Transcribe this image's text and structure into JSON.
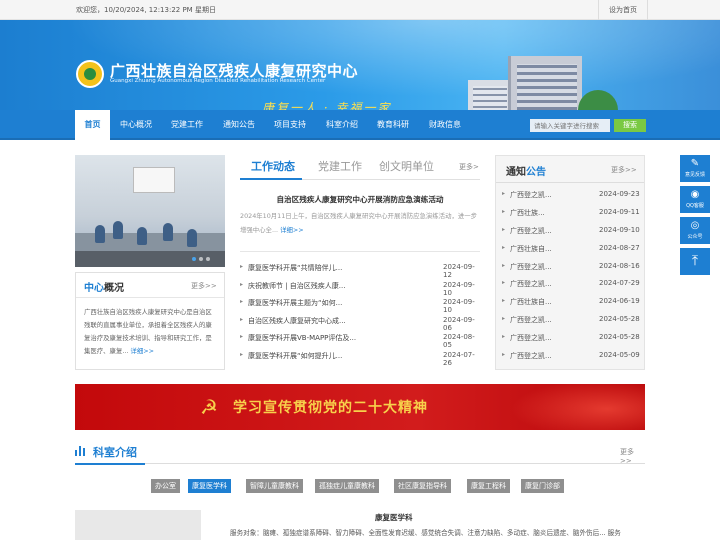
{
  "topbar": {
    "welcome": "欢迎您，10/20/2024, 12:13:22 PM 星期日",
    "set_home": "设为首页"
  },
  "header": {
    "title": "广西壮族自治区残疾人康复研究中心",
    "subtitle": "Guangxi Zhuang Autonomous Region Disabled Rehabilitation Research Center",
    "slogan": "康复一人 · 幸福一家"
  },
  "nav": {
    "items": [
      {
        "label": "首页",
        "active": true
      },
      {
        "label": "中心概况"
      },
      {
        "label": "党建工作"
      },
      {
        "label": "通知公告"
      },
      {
        "label": "项目支持"
      },
      {
        "label": "科室介绍"
      },
      {
        "label": "教育科研"
      },
      {
        "label": "财政信息"
      }
    ],
    "search_placeholder": "请输入关键字进行搜索",
    "search_button": "搜索"
  },
  "intro": {
    "title_a": "中心",
    "title_b": "概况",
    "more": "更多>>",
    "text": "广西壮族自治区残疾人康复研究中心是自治区残联的直属事业单位，承担着全区残疾人的康复治疗及康复技术培训、指导和研究工作，是集医疗、康复...",
    "link": "详细>>"
  },
  "news": {
    "tabs": [
      "工作动态",
      "党建工作",
      "创文明单位"
    ],
    "more": "更多>",
    "headline": "自治区残疾人康复研究中心开展消防应急演练活动",
    "summary": "2024年10月11日上午，自治区残疾人康复研究中心开展消防应急演练活动，进一步增强中心全...",
    "summary_link": "详细>>",
    "items": [
      {
        "title": "康复医学科开展“共情陪伴儿...",
        "date": "2024-09-12"
      },
      {
        "title": "庆祝教师节 | 自治区残疾人康...",
        "date": "2024-09-10"
      },
      {
        "title": "康复医学科开展主题为“如何...",
        "date": "2024-09-10"
      },
      {
        "title": "自治区残疾人康复研究中心成...",
        "date": "2024-09-06"
      },
      {
        "title": "康复医学科开展VB-MAPP评估及...",
        "date": "2024-08-05"
      },
      {
        "title": "康复医学科开展“如何提升儿...",
        "date": "2024-07-26"
      }
    ]
  },
  "notice": {
    "title_a": "通知",
    "title_b": "公告",
    "more": "更多>>",
    "items": [
      {
        "title": "广西登之凯...",
        "date": "2024-09-23"
      },
      {
        "title": "广西壮族...",
        "date": "2024-09-11"
      },
      {
        "title": "广西登之凯...",
        "date": "2024-09-10"
      },
      {
        "title": "广西壮族自...",
        "date": "2024-08-27"
      },
      {
        "title": "广西登之凯...",
        "date": "2024-08-16"
      },
      {
        "title": "广西登之凯...",
        "date": "2024-07-29"
      },
      {
        "title": "广西壮族自...",
        "date": "2024-06-19"
      },
      {
        "title": "广西登之凯...",
        "date": "2024-05-28"
      },
      {
        "title": "广西登之凯...",
        "date": "2024-05-28"
      },
      {
        "title": "广西登之凯...",
        "date": "2024-05-09"
      }
    ]
  },
  "float_bar": [
    {
      "label": "意见反馈",
      "glyph": "✎",
      "icon": "edit-icon"
    },
    {
      "label": "QQ客服",
      "glyph": "◉",
      "icon": "qq-icon"
    },
    {
      "label": "公众号",
      "glyph": "◎",
      "icon": "wechat-icon"
    },
    {
      "label": "",
      "glyph": "⤒",
      "icon": "back-to-top-icon"
    }
  ],
  "party_banner": {
    "text": "学习宣传贯彻党的二十大精神",
    "emblem": "☭"
  },
  "dept": {
    "title_a": "科室",
    "title_b": "介绍",
    "more": "更多>>",
    "tabs": [
      {
        "label": "办公室"
      },
      {
        "label": "康复医学科",
        "active": true
      },
      {
        "label": "智障儿童康教科"
      },
      {
        "label": "孤独症儿童康教科"
      },
      {
        "label": "社区康复指导科"
      },
      {
        "label": "康复工程科"
      },
      {
        "label": "康复门诊部"
      }
    ],
    "detail_title": "康复医学科",
    "detail_text": "服务对象：脑瘫、孤独症谱系障碍、智力障碍、全面性发育迟缓、感觉统合失调、注意力缺陷、多动症、脑炎后遗症、脑外伤后... 服务"
  },
  "colors": {
    "primary": "#1e7fd2",
    "accent_green": "#7ac943",
    "party_red": "#c3090b",
    "party_gold": "#f7d04b"
  }
}
